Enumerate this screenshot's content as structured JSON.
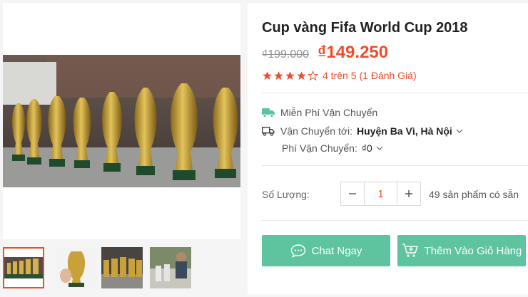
{
  "product": {
    "title": "Cup vàng Fifa World Cup 2018",
    "price_original": "₫199.000",
    "price_sale": "₫149.250",
    "rating": {
      "stars": 4,
      "max": 5,
      "text": "4 trên 5",
      "count_text": "(1 Đánh Giá)"
    }
  },
  "shipping": {
    "free_badge_icon": "free-shipping-truck-icon",
    "free_label": "Miễn Phí Vận Chuyển",
    "to_label": "Vận Chuyển tới:",
    "to_value": "Huyện Ba Vì, Hà Nội",
    "fee_label": "Phí Vận Chuyển:",
    "fee_value": "₫0"
  },
  "quantity": {
    "label": "Số Lượng:",
    "value": "1",
    "stock_text": "49 sản phẩm có sẵn"
  },
  "actions": {
    "chat_label": "Chat Ngay",
    "add_to_cart_label": "Thêm Vào Giỏ Hàng"
  },
  "colors": {
    "accent": "#ee4d2d",
    "action_green": "#5ec4a0",
    "free_ship_green": "#5ec4a0"
  }
}
